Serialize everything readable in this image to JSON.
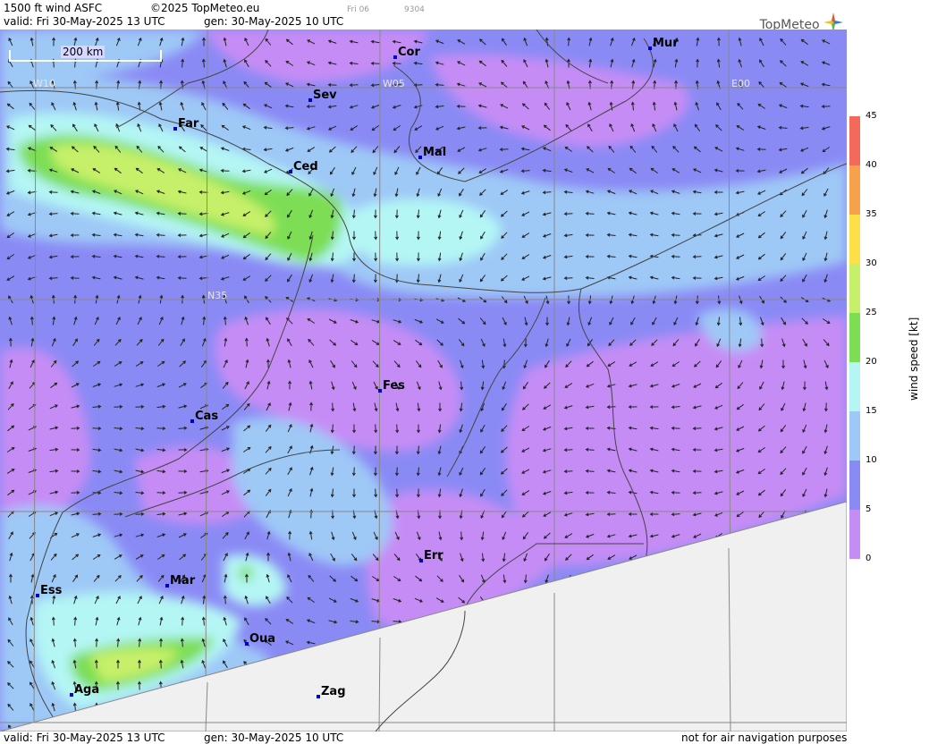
{
  "header": {
    "product": "1500 ft wind ASFC",
    "copyright": "©2025 TopMeteo.eu",
    "day_tag": "Fri 06",
    "code": "9304",
    "valid": "valid:  Fri  30-May-2025  13 UTC",
    "gen": "gen: 30-May-2025 10 UTC",
    "logo": "TopMeteo"
  },
  "scale_label": "200 km",
  "grid_labels": [
    "W10",
    "W05",
    "E00",
    "N35"
  ],
  "cities": [
    "Cor",
    "Mur",
    "Sev",
    "Far",
    "Mal",
    "Ced",
    "Fes",
    "Cas",
    "Err",
    "Ess",
    "Mar",
    "Oua",
    "Aga",
    "Zag"
  ],
  "legend": {
    "title": "wind  speed  [kt]",
    "ticks": [
      "45",
      "40",
      "35",
      "30",
      "25",
      "20",
      "15",
      "10",
      "5",
      "0"
    ],
    "colors": [
      "#f36a5a",
      "#f7a24a",
      "#fde047",
      "#c7f06a",
      "#7dde54",
      "#b4f6f4",
      "#9ec8f6",
      "#8a8af5",
      "#c68cf5"
    ]
  },
  "footer": {
    "valid": "valid:  Fri  30-May-2025  13 UTC",
    "gen": "gen: 30-May-2025 10 UTC",
    "note": "not for air navigation purposes"
  }
}
